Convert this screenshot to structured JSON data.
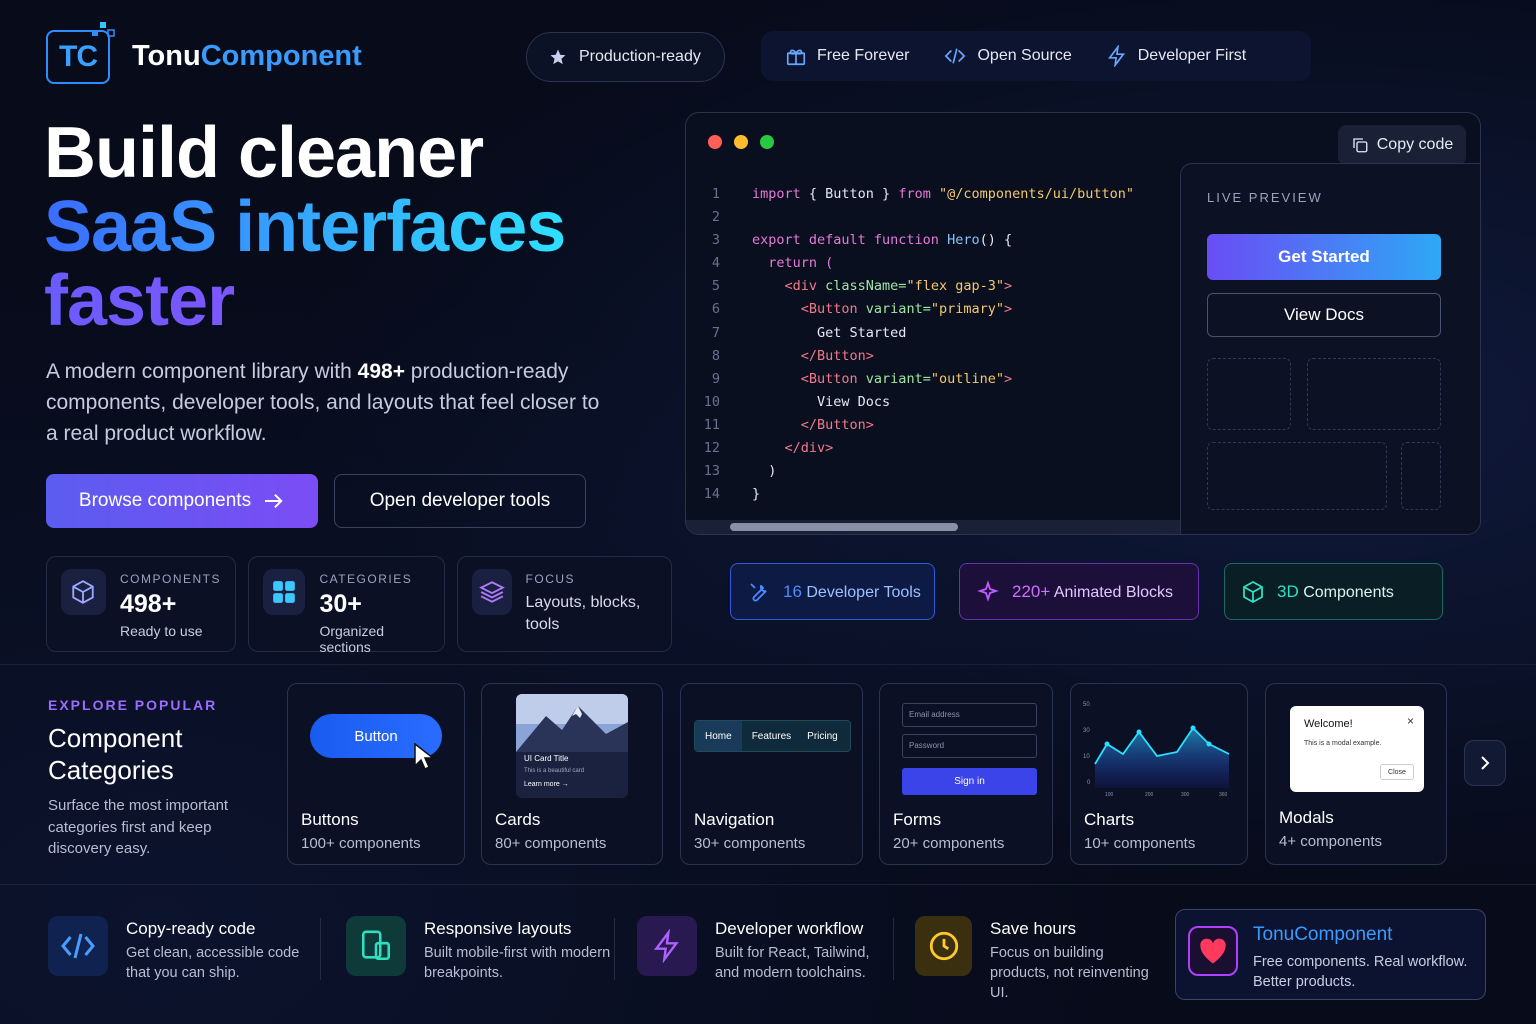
{
  "brand": {
    "logo_initials": "TC",
    "name_part1": "Tonu",
    "name_part2": "Component"
  },
  "header": {
    "badge_label": "Production-ready",
    "features": [
      {
        "icon": "gift-icon",
        "label": "Free Forever"
      },
      {
        "icon": "code-icon",
        "label": "Open Source"
      },
      {
        "icon": "bolt-icon",
        "label": "Developer First"
      }
    ]
  },
  "hero": {
    "line1": "Build cleaner",
    "line2": "SaaS interfaces",
    "line3": "faster",
    "sub_before": "A modern component library with ",
    "sub_bold": "498+",
    "sub_after": " production-ready components, developer tools, and layouts that feel closer to a real product workflow.",
    "primary_button": "Browse components",
    "secondary_button": "Open developer tools"
  },
  "stats": [
    {
      "label": "COMPONENTS",
      "value": "498+",
      "caption": "Ready to use"
    },
    {
      "label": "CATEGORIES",
      "value": "30+",
      "caption": "Organized sections"
    },
    {
      "label": "FOCUS",
      "value": "Layouts, blocks, tools"
    }
  ],
  "code_window": {
    "copy_label": "Copy code",
    "lines": [
      "1",
      "2",
      "3",
      "4",
      "5",
      "6",
      "7",
      "8",
      "9",
      "10",
      "11",
      "12",
      "13",
      "14"
    ],
    "code_tokens": {
      "l1_import": "import",
      "l1_mid": " { Button } ",
      "l1_from": "from",
      "l1_str": "\"@/components/ui/button\"",
      "l3_export": "export default function",
      "l3_name": " Hero",
      "l3_rest": "() {",
      "l4": "  return (",
      "l5_open": "    <div",
      "l5_attr": " className=",
      "l5_val": "\"flex gap-3\"",
      "l5_close": ">",
      "l6_open": "      <Button",
      "l6_attr": " variant=",
      "l6_val": "\"primary\"",
      "l6_close": ">",
      "l7": "        Get Started",
      "l8": "      </Button>",
      "l9_open": "      <Button",
      "l9_attr": " variant=",
      "l9_val": "\"outline\"",
      "l9_close": ">",
      "l10": "        View Docs",
      "l11": "      </Button>",
      "l12": "    </div>",
      "l13": "  )",
      "l14": "}"
    },
    "preview_label": "LIVE PREVIEW",
    "preview_primary": "Get Started",
    "preview_secondary": "View Docs"
  },
  "tags": [
    {
      "value": "16",
      "label": "Developer Tools",
      "color": "#4a8cff"
    },
    {
      "value": "220+",
      "label": "Animated Blocks",
      "color": "#c05cff"
    },
    {
      "value": "3D",
      "label": "Components",
      "color": "#2ee0c0"
    }
  ],
  "categories": {
    "eyebrow": "EXPLORE POPULAR",
    "title_line1": "Component",
    "title_line2": "Categories",
    "description": "Surface the most important categories first and keep discovery easy.",
    "cards": [
      {
        "title": "Buttons",
        "count": "100+ components",
        "preview_button": "Button"
      },
      {
        "title": "Cards",
        "count": "80+ components",
        "preview_title": "UI Card Title",
        "preview_text": "This is a beautiful card",
        "preview_link": "Learn more"
      },
      {
        "title": "Navigation",
        "count": "30+ components",
        "preview_items": [
          "Home",
          "Features",
          "Pricing"
        ]
      },
      {
        "title": "Forms",
        "count": "20+ components",
        "preview_email": "Email address",
        "preview_password": "Password",
        "preview_submit": "Sign in"
      },
      {
        "title": "Charts",
        "count": "10+ components",
        "y_ticks": [
          "50",
          "30",
          "10",
          "0"
        ],
        "x_ticks": [
          "100",
          "200",
          "300",
          "360"
        ]
      },
      {
        "title": "Modals",
        "count": "4+ components",
        "preview_title": "Welcome!",
        "preview_text": "This is a modal example.",
        "preview_close": "Close"
      }
    ]
  },
  "footer": [
    {
      "title": "Copy-ready code",
      "desc": "Get clean, accessible code that you can ship.",
      "icon": "code-icon"
    },
    {
      "title": "Responsive layouts",
      "desc": "Built mobile-first with modern breakpoints.",
      "icon": "devices-icon"
    },
    {
      "title": "Developer workflow",
      "desc": "Built for React, Tailwind, and modern toolchains.",
      "icon": "bolt-icon"
    },
    {
      "title": "Save hours",
      "desc": "Focus on building products, not reinventing UI.",
      "icon": "clock-icon"
    }
  ],
  "promo": {
    "title": "TonuComponent",
    "desc": "Free components. Real workflow. Better products.",
    "icon": "heart-icon"
  }
}
